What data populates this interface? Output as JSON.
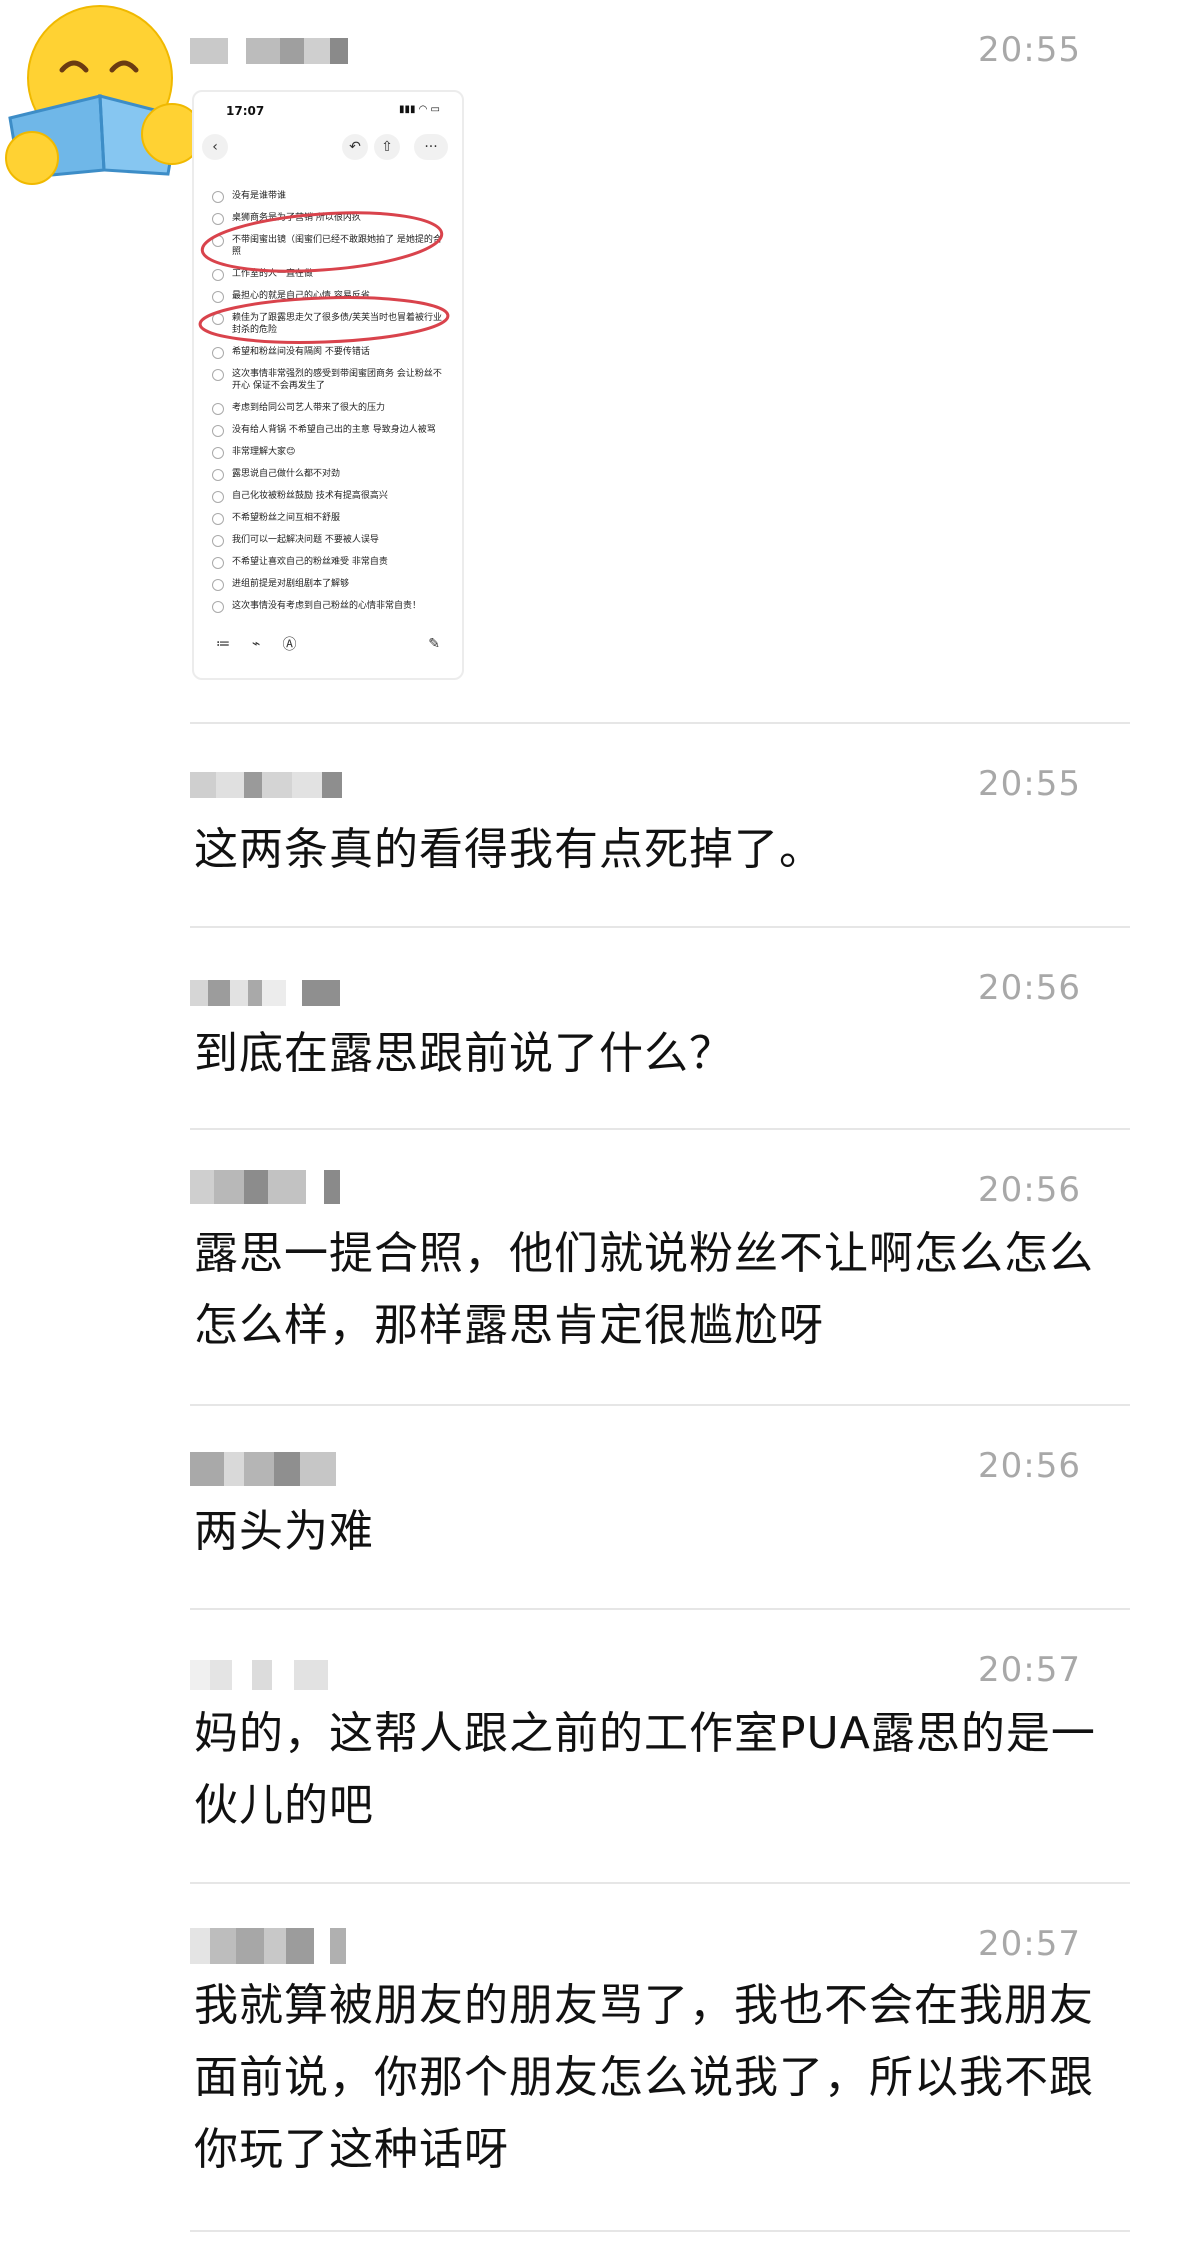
{
  "screenshot": {
    "status_time": "17:07",
    "status_icons": "▮▮▮ ◠ ▭",
    "toolbar": {
      "back_icon": "‹",
      "undo_icon": "↶",
      "share_icon": "⇧",
      "more_icon": "···"
    },
    "items": [
      "没有是谁带谁",
      "桌狮商务是为了营销 所以很内疚",
      "不带闺蜜出镜（闺蜜们已经不敢跟她拍了 是她提的合照",
      "工作室的人一直在做",
      "最担心的就是自己的心情 容易反省",
      "赖佳为了跟露思走欠了很多债/芙芙当时也冒着被行业封杀的危险",
      "希望和粉丝间没有隔阂 不要传错话",
      "这次事情非常强烈的感受到带闺蜜团商务 会让粉丝不开心 保证不会再发生了",
      "考虑到给同公司艺人带来了很大的压力",
      "没有给人背锅 不希望自己出的主意 导致身边人被骂",
      "非常理解大家😊",
      "露思说自己做什么都不对劲",
      "自己化妆被粉丝鼓励 技术有提高很高兴",
      "不希望粉丝之间互相不舒服",
      "我们可以一起解决问题 不要被人误导",
      "不希望让喜欢自己的粉丝难受 非常自责",
      "进组前提是对剧组剧本了解够",
      "这次事情没有考虑到自己粉丝的心情非常自责！"
    ],
    "bottom_icons": [
      "≔",
      "⌁",
      "Ⓐ",
      "✎"
    ]
  },
  "messages": [
    {
      "time": "20:55",
      "text": ""
    },
    {
      "time": "20:55",
      "text": "这两条真的看得我有点死掉了。"
    },
    {
      "time": "20:56",
      "text": "到底在露思跟前说了什么？"
    },
    {
      "time": "20:56",
      "text": "露思一提合照，他们就说粉丝不让啊怎么怎么怎么样，那样露思肯定很尴尬呀"
    },
    {
      "time": "20:56",
      "text": "两头为难"
    },
    {
      "time": "20:57",
      "text": "妈的，这帮人跟之前的工作室PUA露思的是一伙儿的吧"
    },
    {
      "time": "20:57",
      "text": "我就算被朋友的朋友骂了，我也不会在我朋友面前说，你那个朋友怎么说我了，所以我不跟你玩了这种话呀"
    }
  ],
  "colors": {
    "annotation": "#d9434c",
    "emoji_face": "#ffd233",
    "book": "#6fb7e8",
    "time": "#a8a8a8"
  }
}
